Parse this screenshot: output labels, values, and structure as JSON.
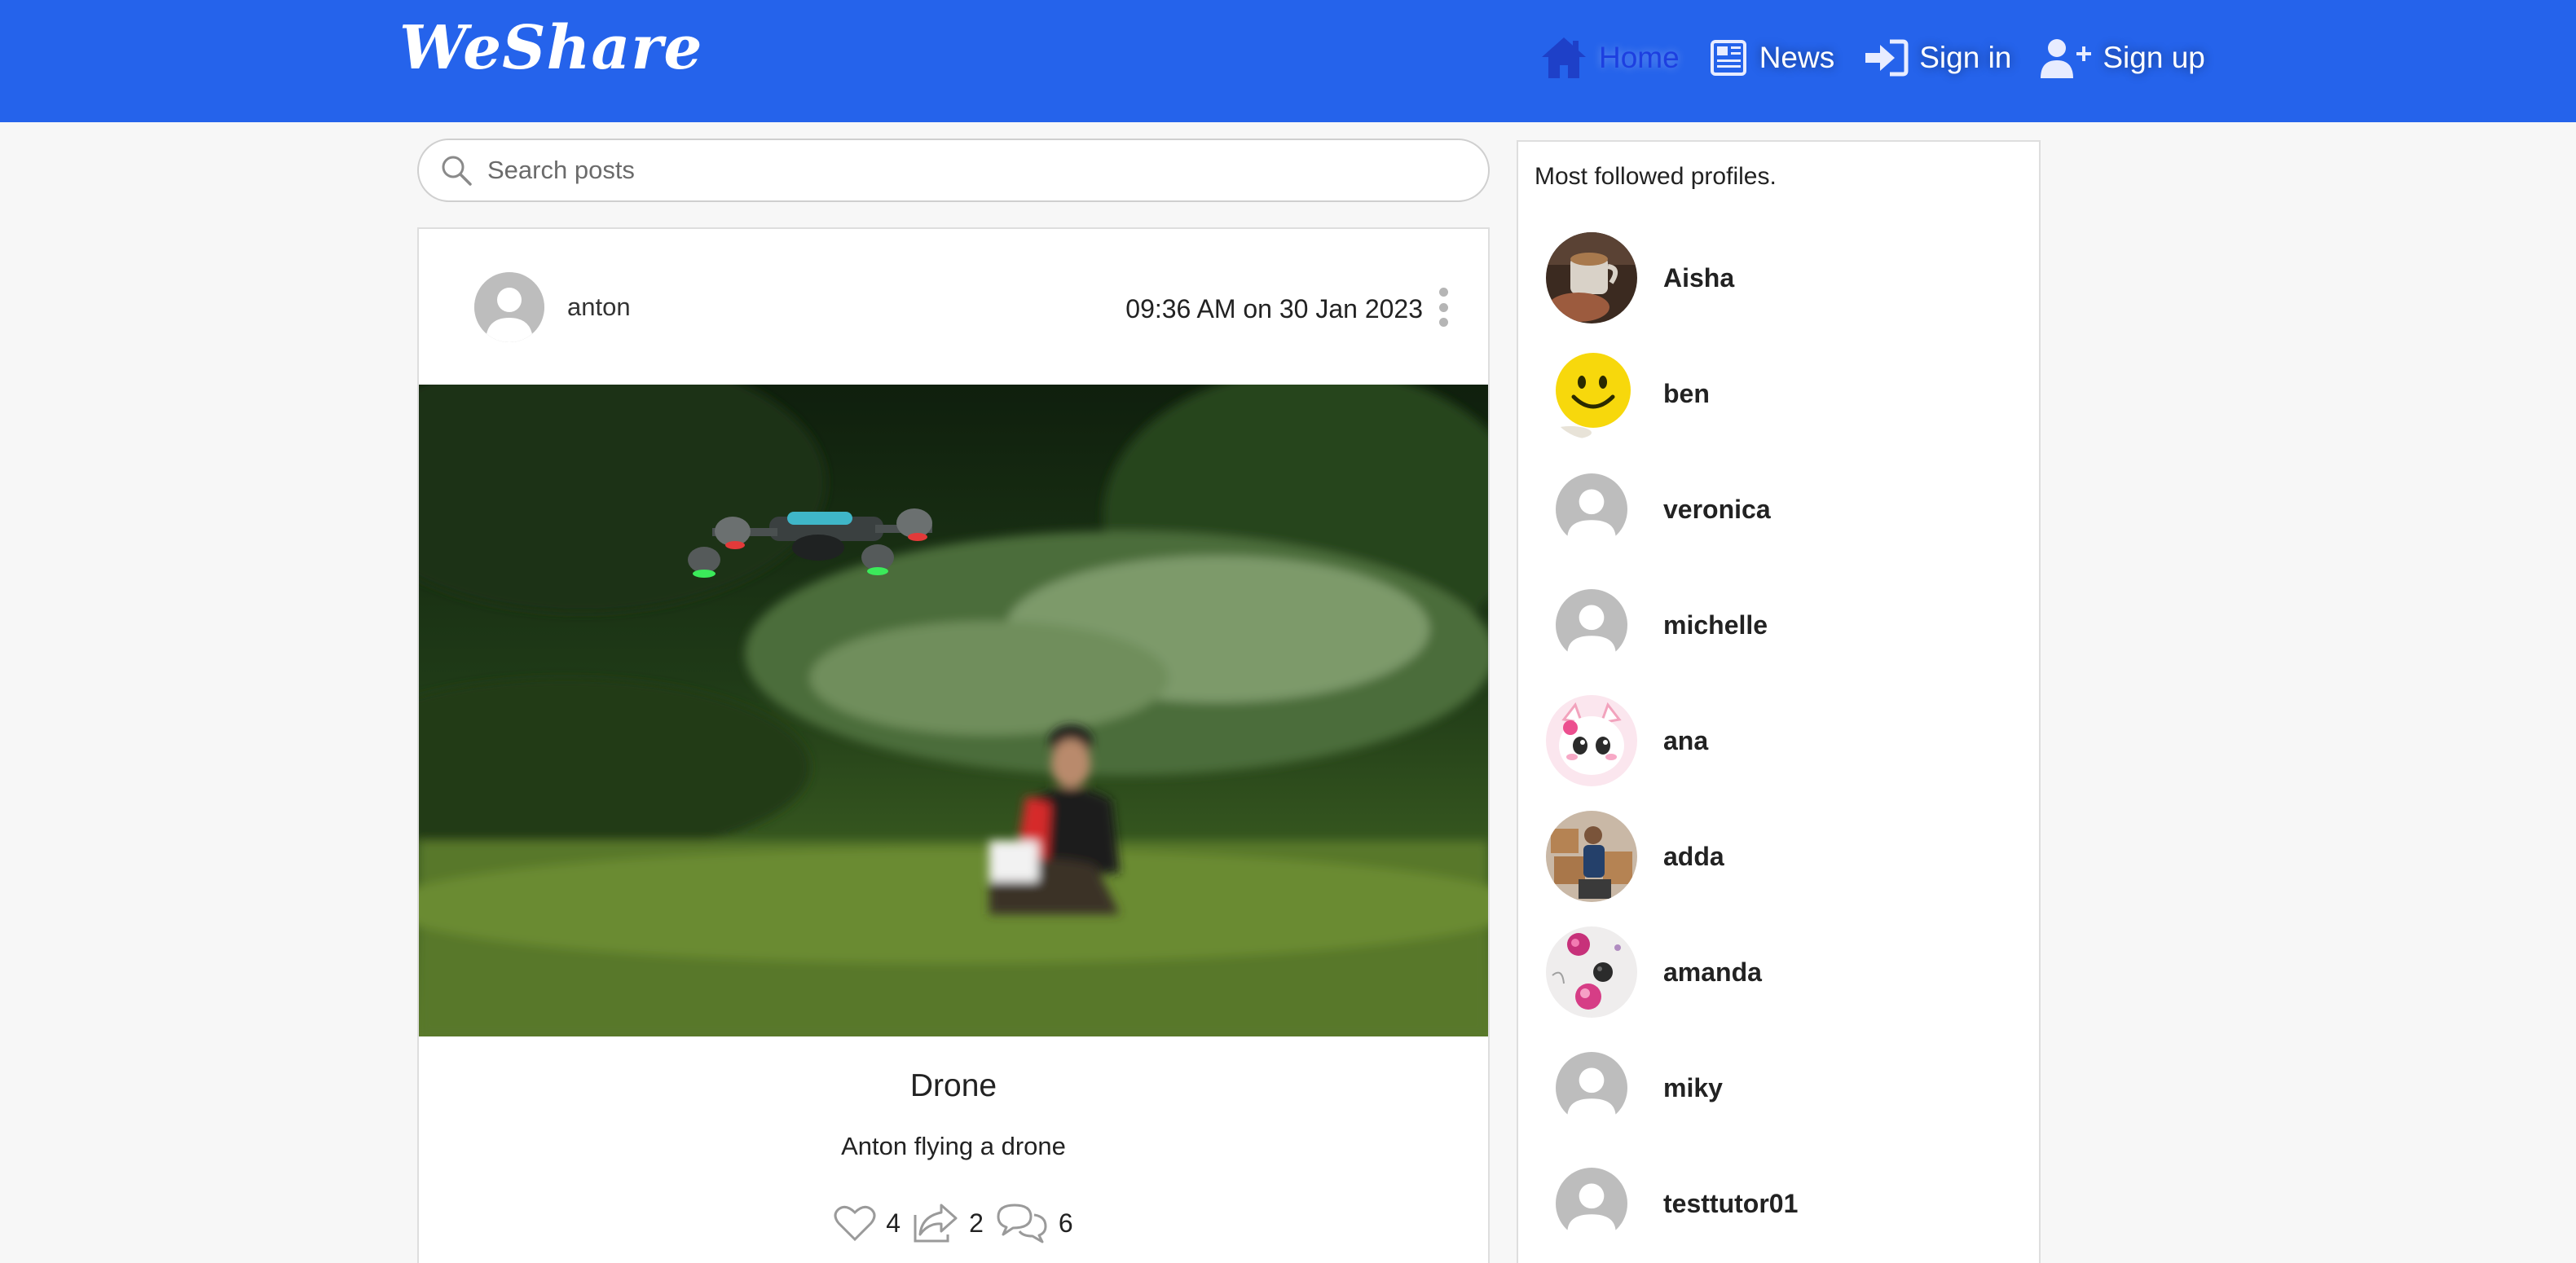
{
  "brand": {
    "name": "WeShare",
    "color": "#ffffff"
  },
  "nav": {
    "background": "#2563eb",
    "items": [
      {
        "label": "Home",
        "icon": "home-icon",
        "active": true
      },
      {
        "label": "News",
        "icon": "newspaper-icon",
        "active": false
      },
      {
        "label": "Sign in",
        "icon": "sign-in-icon",
        "active": false
      },
      {
        "label": "Sign up",
        "icon": "user-plus-icon",
        "active": false
      }
    ]
  },
  "search": {
    "placeholder": "Search posts",
    "value": "",
    "icon": "search-icon"
  },
  "post": {
    "author": "anton",
    "timestamp": "09:36 AM on 30 Jan 2023",
    "menu_icon": "kebab-menu-icon",
    "image": "photo of a man in a meadow flying a drone",
    "title": "Drone",
    "description": "Anton flying a drone",
    "likes": "4",
    "shares": "2",
    "comments": "6"
  },
  "sidebar": {
    "title": "Most followed profiles.",
    "profiles": [
      {
        "name": "Aisha",
        "avatar": "coffee-cup-photo"
      },
      {
        "name": "ben",
        "avatar": "smiley-ball-photo"
      },
      {
        "name": "veronica",
        "avatar": "default-avatar"
      },
      {
        "name": "michelle",
        "avatar": "default-avatar"
      },
      {
        "name": "ana",
        "avatar": "pink-cat-cartoon"
      },
      {
        "name": "adda",
        "avatar": "person-with-boxes-photo"
      },
      {
        "name": "amanda",
        "avatar": "flowers-photo"
      },
      {
        "name": "miky",
        "avatar": "default-avatar"
      },
      {
        "name": "testtutor01",
        "avatar": "default-avatar"
      }
    ]
  }
}
